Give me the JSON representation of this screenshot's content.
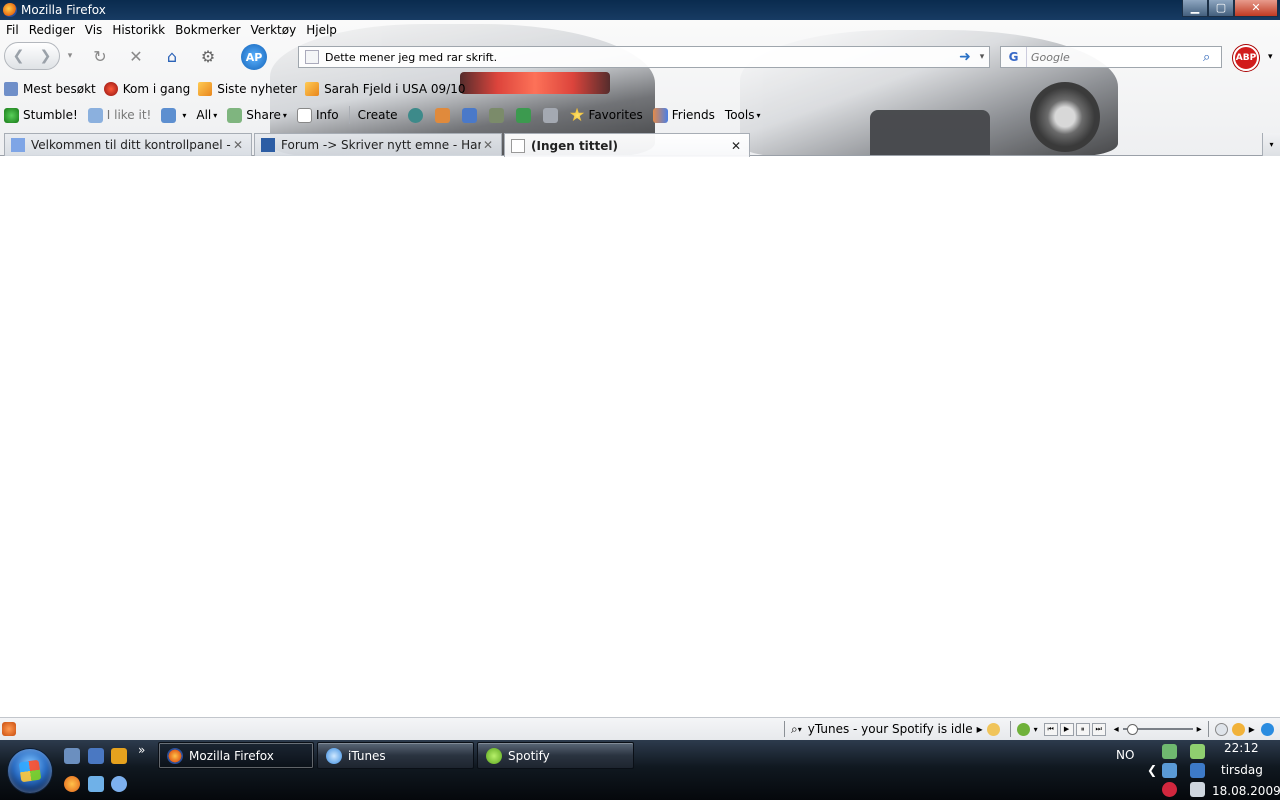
{
  "window": {
    "title": "Mozilla Firefox"
  },
  "window_buttons": {
    "minimize": "▁",
    "maximize": "▢",
    "close": "✕"
  },
  "menu": [
    "Fil",
    "Rediger",
    "Vis",
    "Historikk",
    "Bokmerker",
    "Verktøy",
    "Hjelp"
  ],
  "nav": {
    "url": "Dette mener jeg med rar skrift.",
    "search_placeholder": "Google",
    "search_engine_icon": "G",
    "ap_label": "AP",
    "abp_label": "ABP",
    "icons": {
      "back": "❮",
      "forward": "❯",
      "dropdown": "▾",
      "reload": "↻",
      "stop": "✕",
      "home": "⌂",
      "addon": "⚙",
      "go": "➜",
      "search": "⌕"
    }
  },
  "bookmarks": [
    "Mest besøkt",
    "Kom i gang",
    "Siste nyheter",
    "Sarah Fjeld i USA 09/10"
  ],
  "stumble": {
    "stumble": "Stumble!",
    "like": "I like it!",
    "all": "All",
    "share": "Share",
    "info": "Info",
    "create": "Create",
    "favorites": "Favorites",
    "friends": "Friends",
    "tools": "Tools",
    "dropdown": "▾"
  },
  "tabs": [
    {
      "label": "Velkommen til ditt kontrollpanel - ..."
    },
    {
      "label": "Forum -> Skriver nytt emne - Hard..."
    },
    {
      "label": "(Ingen tittel)"
    }
  ],
  "tab_close": "✕",
  "alltabs": "▾",
  "status": {
    "now_playing": "yTunes - your Spotify is idle",
    "arrow": "▸",
    "search_ico": "⌕",
    "controls": [
      "⏮",
      "▶",
      "⏸",
      "⏭"
    ],
    "vol_icon": "◂"
  },
  "taskbar": {
    "more": "»",
    "tasks": [
      "Mozilla Firefox",
      "iTunes",
      "Spotify"
    ],
    "lang": "NO",
    "tray_arrow": "❮",
    "time": "22:12",
    "day": "tirsdag",
    "date": "18.08.2009"
  }
}
